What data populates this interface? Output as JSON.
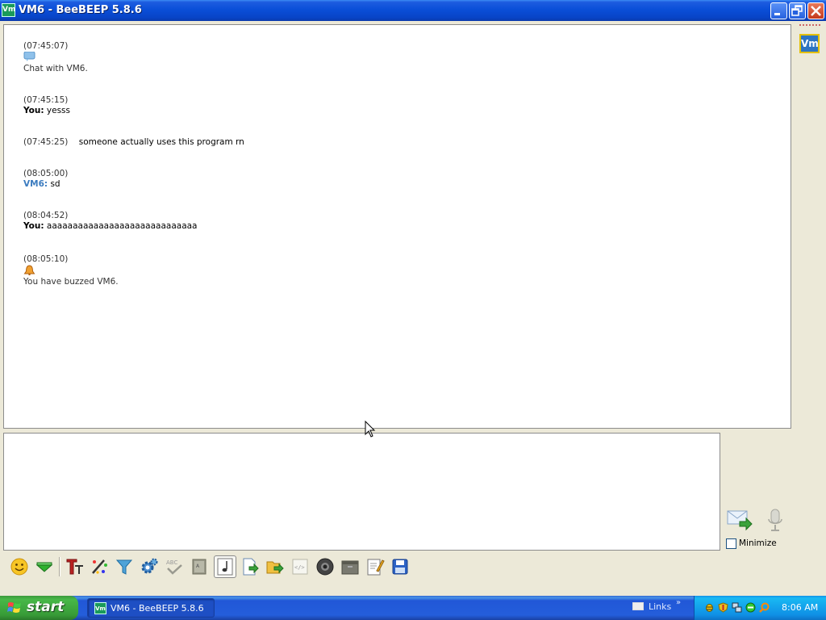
{
  "window": {
    "title": "VM6 - BeeBEEP 5.8.6",
    "icon_label": "Vm",
    "controls": [
      "minimize",
      "restore",
      "close"
    ]
  },
  "chat": {
    "messages": [
      {
        "time": "(07:45:07)",
        "icon": "speech-bubble-icon",
        "speaker": "",
        "text": "Chat with VM6."
      },
      {
        "time": "(07:45:15)",
        "icon": "",
        "speaker": "You:",
        "text": " yesss"
      },
      {
        "time": "(07:45:25)",
        "icon": "",
        "speaker": "",
        "text": "    someone actually uses this program rn"
      },
      {
        "time": "(08:05:00)",
        "icon": "",
        "speaker": "VM6:",
        "text": " sd"
      },
      {
        "time": "(08:04:52)",
        "icon": "",
        "speaker": "You:",
        "text": " aaaaaaaaaaaaaaaaaaaaaaaaaaaaa"
      },
      {
        "time": "(08:05:10)",
        "icon": "bell-buzz-icon",
        "speaker": "",
        "text": "You have buzzed VM6."
      }
    ]
  },
  "compose": {
    "value": ""
  },
  "send_area": {
    "minimize_label": "Minimize",
    "minimize_checked": false
  },
  "user_panel": {
    "avatar_label": "Vm"
  },
  "toolbar": {
    "buttons": [
      "emoticon-icon",
      "color-drop-icon",
      "font-icon",
      "font-color-icon",
      "filter-icon",
      "settings-gear-icon",
      "spellcheck-icon",
      "dictionary-icon",
      "sound-note-icon",
      "send-file-icon",
      "send-folder-icon",
      "html-code-icon",
      "screenshot-icon",
      "clear-chat-icon",
      "edit-note-icon",
      "save-chat-icon"
    ]
  },
  "taskbar": {
    "start_label": "start",
    "task_label": "VM6 - BeeBEEP 5.8.6",
    "task_icon_label": "Vm",
    "links_label": "Links",
    "links_chevron": "»",
    "clock": "8:06 AM"
  },
  "colors": {
    "title_bar": "#0a4fd8",
    "peer_name": "#3b7bbf",
    "taskbar": "#245edb",
    "start_button": "#3c9a3c"
  }
}
